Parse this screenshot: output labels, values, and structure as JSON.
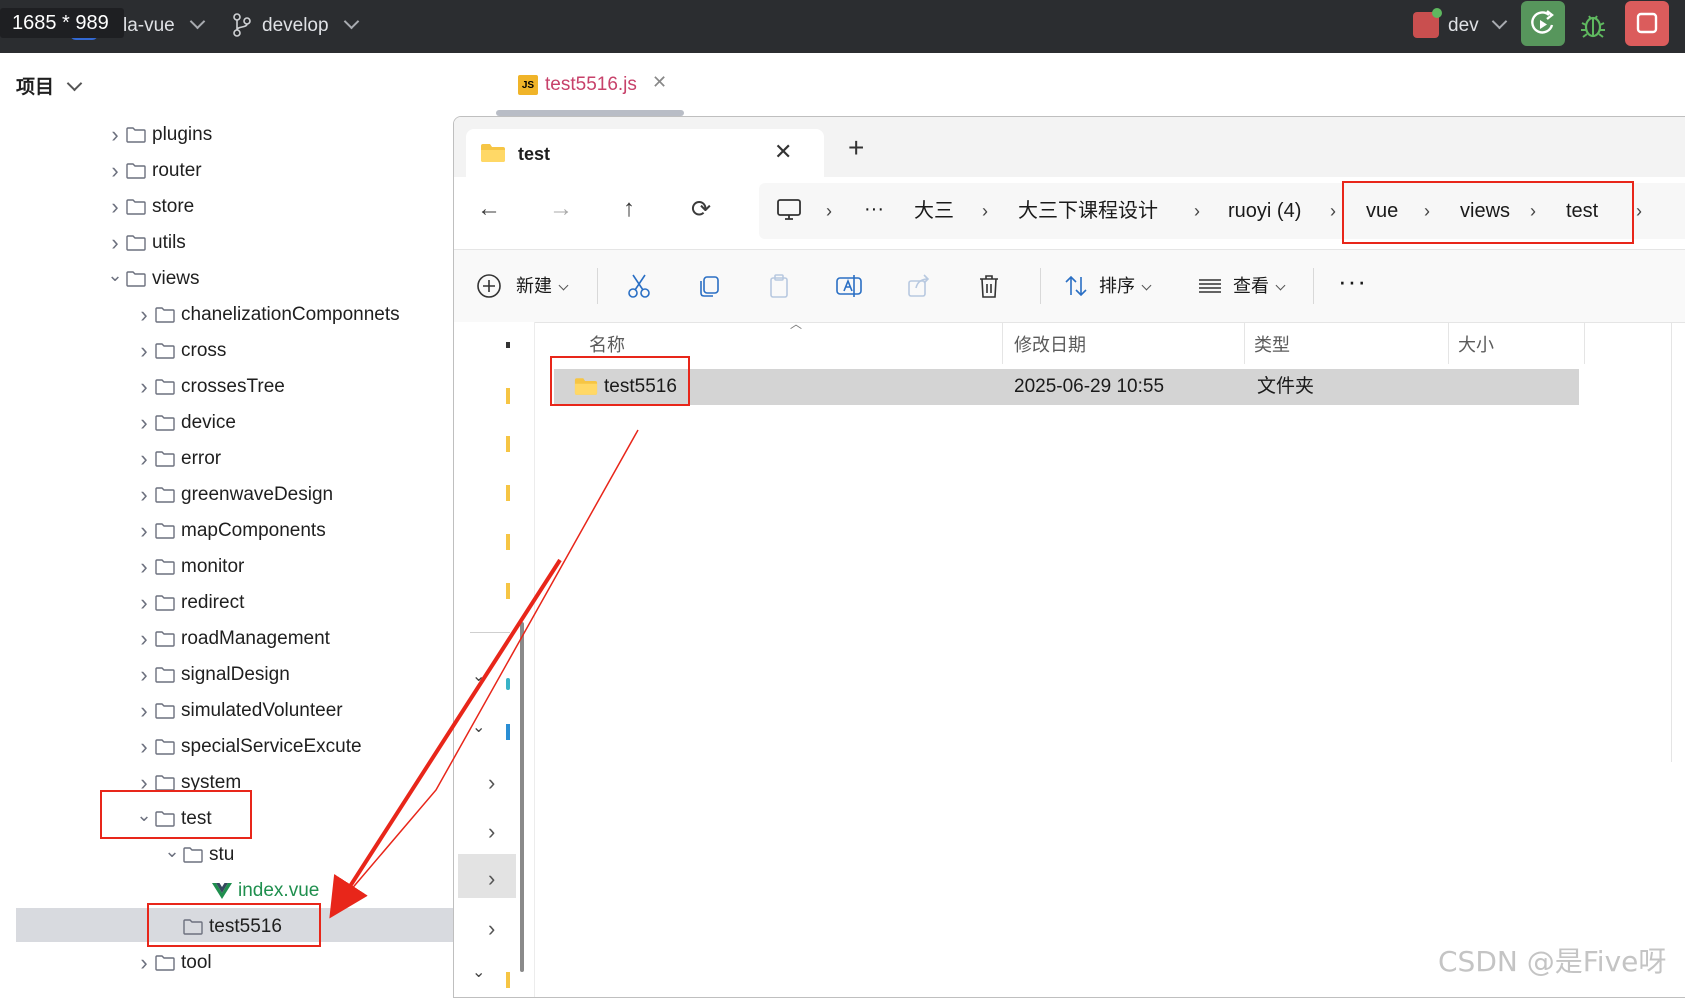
{
  "screen_size_label": "1685 * 989",
  "topbar": {
    "project_name": "zkla-vue",
    "branch": "develop",
    "run_config": "dev"
  },
  "project_panel": {
    "title": "项目",
    "tree": [
      {
        "label": "plugins",
        "type": "folder",
        "expanded": false,
        "depth": 0
      },
      {
        "label": "router",
        "type": "folder",
        "expanded": false,
        "depth": 0
      },
      {
        "label": "store",
        "type": "folder",
        "expanded": false,
        "depth": 0
      },
      {
        "label": "utils",
        "type": "folder",
        "expanded": false,
        "depth": 0
      },
      {
        "label": "views",
        "type": "folder",
        "expanded": true,
        "depth": 0
      },
      {
        "label": "chanelizationComponnets",
        "type": "folder",
        "expanded": false,
        "depth": 1
      },
      {
        "label": "cross",
        "type": "folder",
        "expanded": false,
        "depth": 1
      },
      {
        "label": "crossesTree",
        "type": "folder",
        "expanded": false,
        "depth": 1
      },
      {
        "label": "device",
        "type": "folder",
        "expanded": false,
        "depth": 1
      },
      {
        "label": "error",
        "type": "folder",
        "expanded": false,
        "depth": 1
      },
      {
        "label": "greenwaveDesign",
        "type": "folder",
        "expanded": false,
        "depth": 1
      },
      {
        "label": "mapComponents",
        "type": "folder",
        "expanded": false,
        "depth": 1
      },
      {
        "label": "monitor",
        "type": "folder",
        "expanded": false,
        "depth": 1
      },
      {
        "label": "redirect",
        "type": "folder",
        "expanded": false,
        "depth": 1
      },
      {
        "label": "roadManagement",
        "type": "folder",
        "expanded": false,
        "depth": 1
      },
      {
        "label": "signalDesign",
        "type": "folder",
        "expanded": false,
        "depth": 1
      },
      {
        "label": "simulatedVolunteer",
        "type": "folder",
        "expanded": false,
        "depth": 1
      },
      {
        "label": "specialServiceExcute",
        "type": "folder",
        "expanded": false,
        "depth": 1
      },
      {
        "label": "system",
        "type": "folder",
        "expanded": false,
        "depth": 1
      },
      {
        "label": "test",
        "type": "folder",
        "expanded": true,
        "depth": 1
      },
      {
        "label": "stu",
        "type": "folder",
        "expanded": true,
        "depth": 2
      },
      {
        "label": "index.vue",
        "type": "vue",
        "expanded": null,
        "depth": 3
      },
      {
        "label": "test5516",
        "type": "folder",
        "expanded": null,
        "depth": 2,
        "selected": true
      },
      {
        "label": "tool",
        "type": "folder",
        "expanded": false,
        "depth": 1
      }
    ]
  },
  "editor": {
    "tab_icon_text": "JS",
    "tab_label": "test5516.js"
  },
  "explorer": {
    "tab_title": "test",
    "breadcrumbs": [
      "大三",
      "大三下课程设计",
      "ruoyi (4)",
      "vue",
      "views",
      "test"
    ],
    "toolbar": {
      "new_label": "新建",
      "sort_label": "排序",
      "view_label": "查看"
    },
    "columns": [
      "名称",
      "修改日期",
      "类型",
      "大小"
    ],
    "rows": [
      {
        "name": "test5516",
        "modified": "2025-06-29 10:55",
        "type": "文件夹",
        "size": ""
      }
    ]
  },
  "watermark": "CSDN @是Five呀",
  "colors": {
    "ide_topbar": "#2b2d30",
    "run_green": "#57965c",
    "stop_red": "#db5c5c",
    "highlight_red": "#e8261a",
    "vue_green": "#1f8f4e"
  }
}
